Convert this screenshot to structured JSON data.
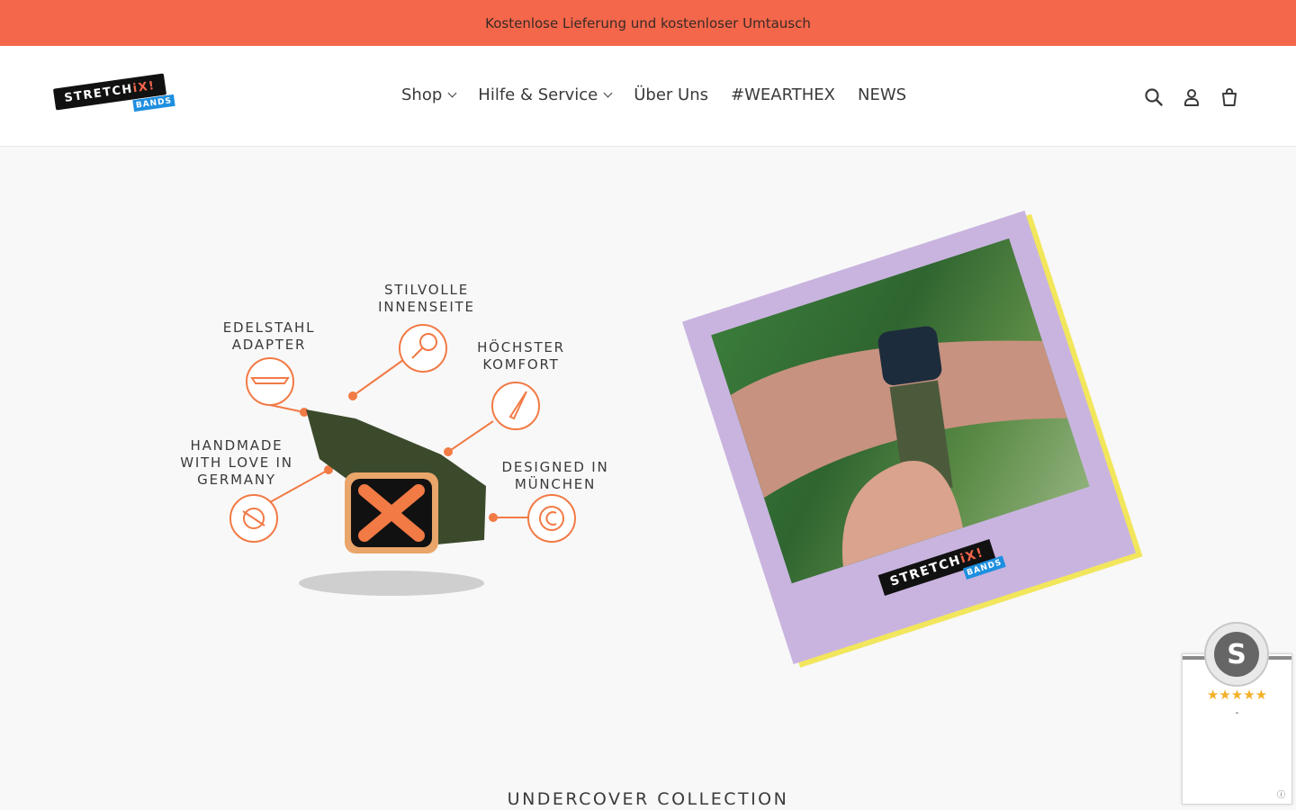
{
  "announcement": {
    "text": "Kostenlose Lieferung und kostenloser Umtausch"
  },
  "brand": {
    "logo_main": "STRETCHiX!",
    "logo_sub": "BANDS"
  },
  "nav": {
    "items": [
      {
        "label": "Shop",
        "has_dropdown": true
      },
      {
        "label": "Hilfe & Service",
        "has_dropdown": true
      },
      {
        "label": "Über Uns",
        "has_dropdown": false
      },
      {
        "label": "#WEARTHEX",
        "has_dropdown": false
      },
      {
        "label": "NEWS",
        "has_dropdown": false
      }
    ]
  },
  "header_icons": [
    "search-icon",
    "account-icon",
    "cart-icon"
  ],
  "infographic": {
    "labels": {
      "stilvolle": "STILVOLLE\nINNENSEITE",
      "edelstahl": "EDELSTAHL\nADAPTER",
      "hoechster": "HÖCHSTER\nKOMFORT",
      "handmade": "HANDMADE\nWITH LOVE IN\nGERMANY",
      "designed": "DESIGNED IN\nMÜNCHEN"
    }
  },
  "photo": {
    "logo_main": "STRETCHiX!",
    "logo_sub": "BANDS"
  },
  "collection": {
    "title": "UNDERCOVER COLLECTION"
  },
  "widget": {
    "seal_letter": "S",
    "stars": "★★★★★",
    "rating": "-",
    "info": "ⓘ"
  },
  "colors": {
    "accent": "#f4674b",
    "brand_blue": "#1e8fe0",
    "polaroid": "#c9b4df",
    "polaroid_edge": "#f2e65c",
    "star": "#f3b028"
  }
}
